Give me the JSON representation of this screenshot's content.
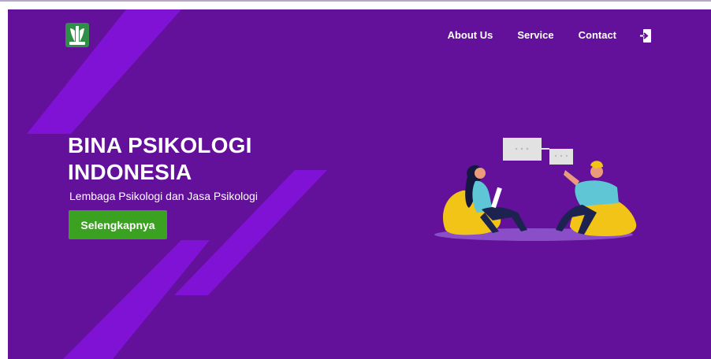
{
  "nav": {
    "logo_icon": "leaf-emblem-icon",
    "links": [
      "About Us",
      "Service",
      "Contact"
    ],
    "login_icon": "login-icon"
  },
  "hero": {
    "title_line1": "BINA PSIKOLOGI",
    "title_line2": "INDONESIA",
    "subtitle": "Lembaga Psikologi dan Jasa Psikologi",
    "cta_label": "Selengkapnya",
    "illustration": "two-people-chatting-illustration"
  },
  "colors": {
    "background": "#63109a",
    "stripe": "#8012d6",
    "button": "#3ba120",
    "logo": "#2f8f46"
  }
}
